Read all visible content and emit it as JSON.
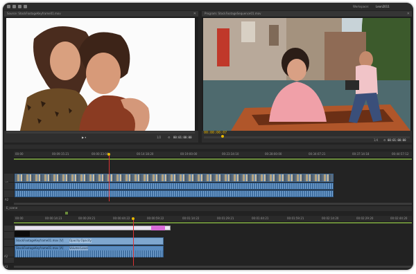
{
  "menubar": {
    "workspace_label": "Workspace:",
    "workspace_value": "Leon2011"
  },
  "source_monitor": {
    "tab_label": "Source: StockFootageKeyframe01.mov",
    "timecode_right": "00:01:00:00",
    "fit_label": "1/2"
  },
  "program_monitor": {
    "tab_label": "Program: StockFootageSequence01.mov",
    "timecode_left": "00:00:00:07",
    "fit_label": "1/4",
    "timecode_right": "00:01:00:00"
  },
  "timeline_top": {
    "ruler_ticks": [
      "00:00",
      "00:09:15:21",
      "00:00:33:04",
      "00:14:18:20",
      "00:19:00:00",
      "00:23:34:10",
      "00:28:00:00",
      "00:34:07:21",
      "00:37:14:18",
      "00:44:57:12"
    ],
    "track_labels": [
      "V1",
      "A1",
      "A2"
    ]
  },
  "timeline_bottom": {
    "tab_label": "E_scene",
    "ruler_ticks": [
      "00:00",
      "00:00:14:23",
      "00:00:29:21",
      "00:00:44:22",
      "00:00:59:22",
      "00:01:14:22",
      "00:01:29:21",
      "00:01:44:21",
      "00:01:59:21",
      "00:02:14:20",
      "00:02:29:20",
      "00:02:44:20"
    ],
    "track_labels": [
      "V2",
      "V1",
      "A1",
      "A2",
      "A3"
    ],
    "clip_video_label": "StockFootageKeyframe01.mov [V]",
    "clip_video_effect": "Opacity:Opacity",
    "clip_audio_label": "StockFootageKeyframe01.mov [A]",
    "clip_audio_effect": "Volume:Level"
  },
  "colors": {
    "accent_timecode": "#e8b800",
    "playhead": "#dd3333",
    "clip_video": "#7fa7cf",
    "clip_audio": "#5b8cc0",
    "clip_pink": "#d86bd8"
  },
  "icons": [
    "selection-tool-icon",
    "ripple-tool-icon",
    "razor-tool-icon",
    "zoom-tool-icon",
    "play-icon",
    "wrench-icon",
    "close-icon"
  ]
}
